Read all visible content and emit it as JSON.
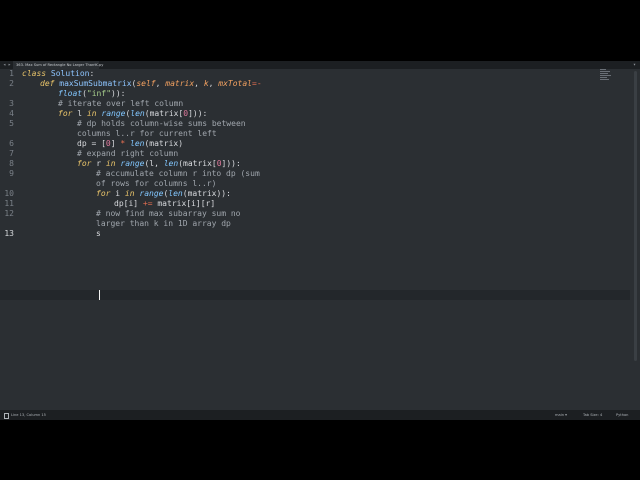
{
  "tab": {
    "nav_left": "◂",
    "nav_right": "▸",
    "title": "363. Max Sum of Rectangle No Larger Than K.py",
    "close": "×",
    "menu": "▾"
  },
  "gutter": [
    "1",
    "2",
    "",
    "3",
    "4",
    "5",
    "",
    "6",
    "7",
    "8",
    "9",
    "",
    "10",
    "11",
    "12",
    "",
    "13"
  ],
  "code": {
    "l1": {
      "kw": "class",
      "cls": "Solution",
      "rest": ":"
    },
    "l2": {
      "kw": "def",
      "fn": "maxSumSubmatrix",
      "p1": "(",
      "self": "self",
      ",1": ", ",
      "matrix": "matrix",
      ",2": ", ",
      "k": "k",
      ",3": ", ",
      "mx": "mxTotal",
      "eq": "=-"
    },
    "l2b": {
      "bi": "float",
      "p1": "(",
      "st": "\"inf\"",
      "p2": ")):"
    },
    "l3": {
      "cm": "# iterate over left column"
    },
    "l4": {
      "kw1": "for",
      "v": " l ",
      "kw2": "in",
      "sp": " ",
      "bi1": "range",
      "p1": "(",
      "bi2": "len",
      "p2": "(matrix[",
      "n": "0",
      "p3": "])):"
    },
    "l5": {
      "cm": "# dp holds column-wise sums between"
    },
    "l5b": {
      "cm": "columns l..r for current left"
    },
    "l6": {
      "a": "dp = [",
      "n": "0",
      "b": "] ",
      "op": "*",
      "sp": " ",
      "bi": "len",
      "c": "(matrix)"
    },
    "l7": {
      "cm": "# expand right column"
    },
    "l8": {
      "kw1": "for",
      "v": " r ",
      "kw2": "in",
      "sp": " ",
      "bi1": "range",
      "p1": "(l, ",
      "bi2": "len",
      "p2": "(matrix[",
      "n": "0",
      "p3": "])):"
    },
    "l9": {
      "cm": "# accumulate column r into dp (sum"
    },
    "l9b": {
      "cm": "of rows for columns l..r)"
    },
    "l10": {
      "kw1": "for",
      "v": " i ",
      "kw2": "in",
      "sp": " ",
      "bi1": "range",
      "p1": "(",
      "bi2": "len",
      "p2": "(matrix)):"
    },
    "l11": {
      "a": "dp[i] ",
      "op": "+=",
      "b": " matrix[i][r]"
    },
    "l12": {
      "cm": "# now find max subarray sum no"
    },
    "l12b": {
      "cm": "larger than k in 1D array dp"
    },
    "l13": {
      "a": "s"
    }
  },
  "status": {
    "position": "Line 13, Column 15",
    "spaces": "main ▾",
    "tab_size": "Tab Size: 4",
    "syntax": "Python"
  },
  "colors": {
    "background": "#2b2f33",
    "keyword": "#e9c46a",
    "function": "#8ec5ff",
    "comment": "#a0a6ad",
    "number": "#e07b9d"
  }
}
